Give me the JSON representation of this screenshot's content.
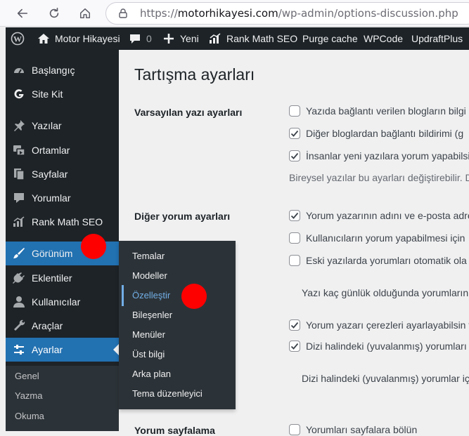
{
  "browser": {
    "url_prefix": "https://",
    "url_domain": "motorhikayesi.com",
    "url_path": "/wp-admin/options-discussion.php"
  },
  "admin_bar": {
    "site_name": "Motor Hikayesi",
    "comments_count": "0",
    "new_label": "Yeni",
    "rank_math": "Rank Math SEO",
    "purge_cache": "Purge cache",
    "wpcode": "WPCode",
    "updraft": "UpdraftPlus"
  },
  "sidebar": {
    "items": [
      {
        "label": "Başlangıç"
      },
      {
        "label": "Site Kit"
      },
      {
        "label": "Yazılar"
      },
      {
        "label": "Ortamlar"
      },
      {
        "label": "Sayfalar"
      },
      {
        "label": "Yorumlar"
      },
      {
        "label": "Rank Math SEO"
      },
      {
        "label": "Görünüm"
      },
      {
        "label": "Eklentiler"
      },
      {
        "label": "Kullanıcılar"
      },
      {
        "label": "Araçlar"
      },
      {
        "label": "Ayarlar"
      }
    ],
    "submenu": [
      "Genel",
      "Yazma",
      "Okuma"
    ]
  },
  "flyout": {
    "items": [
      "Temalar",
      "Modeller",
      "Özelleştir",
      "Bileşenler",
      "Menüler",
      "Üst bilgi",
      "Arka plan",
      "Tema düzenleyici"
    ]
  },
  "content": {
    "title": "Tartışma ayarları",
    "section1": {
      "label": "Varsayılan yazı ayarları",
      "rows": [
        {
          "text": "Yazıda bağlantı verilen blogların bilgi",
          "checked": false
        },
        {
          "text": "Diğer bloglardan bağlantı bildirimi (g",
          "checked": true
        },
        {
          "text": "İnsanlar yeni yazılara yorum yapabilsi",
          "checked": true
        }
      ],
      "note": "Bireysel yazılar bu ayarları değiştirebilir. D"
    },
    "section2": {
      "label": "Diğer yorum ayarları",
      "rows": [
        {
          "text": "Yorum yazarının adını ve e-posta adre",
          "checked": true
        },
        {
          "text": "Kullanıcıların yorum yapabilmesi için",
          "checked": false
        },
        {
          "text": "Eski yazılarda yorumları otomatik ola",
          "checked": false
        }
      ],
      "days_text": "Yazı kaç günlük olduğunda yorumların",
      "rows2": [
        {
          "text": "Yorum yazarı çerezleri ayarlayabilsin v",
          "checked": true
        },
        {
          "text": "Dizi halindeki (yuvalanmış) yorumları",
          "checked": true
        }
      ],
      "threaded_text": "Dizi halindeki (yuvalanmış) yorumlar iç"
    },
    "section3": {
      "label": "Yorum sayfalama",
      "row_text": "Yorumları sayfalara bölün"
    }
  },
  "colors": {
    "admin_dark": "#1d2327",
    "accent_blue": "#2271b1",
    "submenu_link": "#72aee6",
    "annotation_red": "#ff0000"
  }
}
